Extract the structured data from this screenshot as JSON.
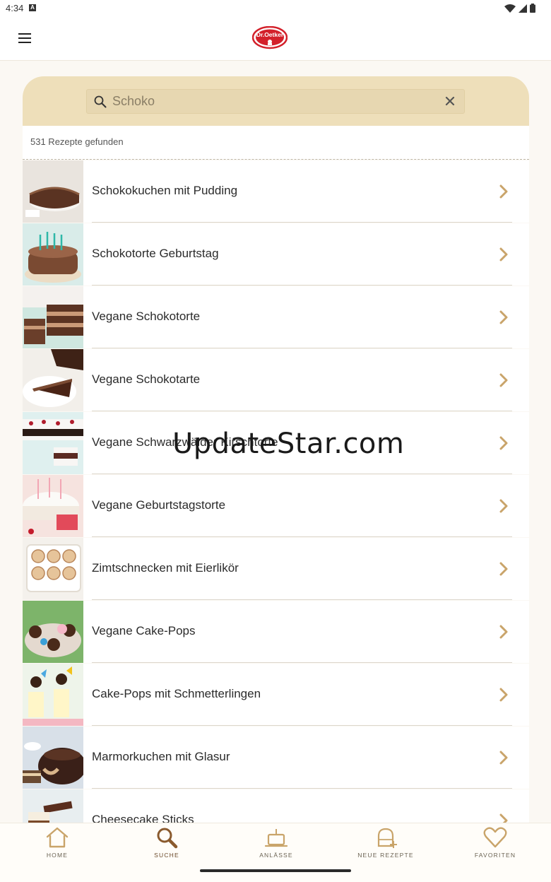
{
  "status_bar": {
    "time": "4:34",
    "notification_badge": "A"
  },
  "app_bar": {
    "logo_text": "Dr.Oetker"
  },
  "search": {
    "value": "Schoko",
    "clear_icon": "close-icon"
  },
  "results": {
    "count_label": "531 Rezepte gefunden"
  },
  "recipes": [
    {
      "title": "Schokokuchen mit Pudding"
    },
    {
      "title": "Schokotorte Geburtstag"
    },
    {
      "title": "Vegane Schokotorte"
    },
    {
      "title": "Vegane Schokotarte"
    },
    {
      "title": "Vegane Schwarzwälder Kirschtorte"
    },
    {
      "title": "Vegane Geburtstagstorte"
    },
    {
      "title": "Zimtschnecken mit Eierlikör"
    },
    {
      "title": "Vegane Cake-Pops"
    },
    {
      "title": "Cake-Pops mit Schmetterlingen"
    },
    {
      "title": "Marmorkuchen mit Glasur"
    },
    {
      "title": "Cheesecake Sticks"
    }
  ],
  "watermark": "UpdateStar.com",
  "bottom_nav": [
    {
      "label": "HOME",
      "icon": "house-icon"
    },
    {
      "label": "SUCHE",
      "icon": "search-icon"
    },
    {
      "label": "ANLÄSSE",
      "icon": "cake-icon"
    },
    {
      "label": "NEUE REZEPTE",
      "icon": "new-recipe-icon"
    },
    {
      "label": "FAVORITEN",
      "icon": "heart-icon"
    }
  ],
  "colors": {
    "accent": "#c9a46a",
    "search_bg": "#eedfba",
    "page_bg": "#fbf8f3",
    "active_nav": "#8a5a2e"
  }
}
